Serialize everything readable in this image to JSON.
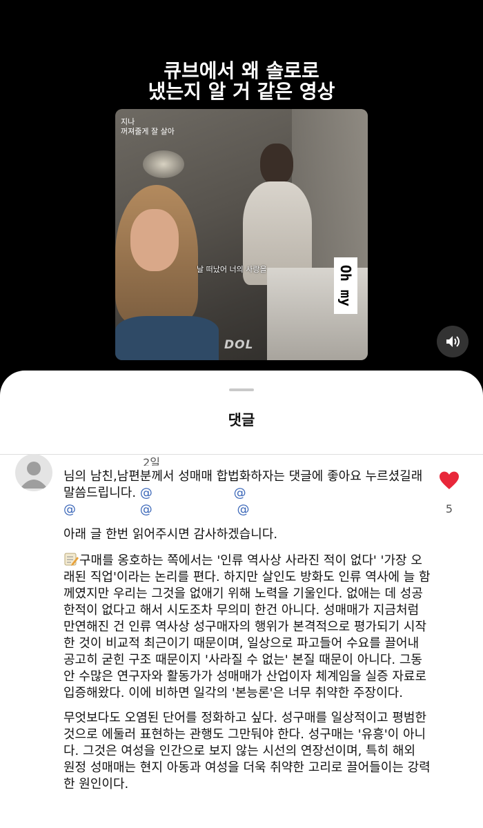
{
  "video": {
    "caption_line1": "큐브에서 왜 솔로로",
    "caption_line2": "냈는지 알 거 같은 영상",
    "overlay_top_line1": "지나",
    "overlay_top_line2": "꺼져줄게 잘 살아",
    "subtitle": "날 떠났어 너의 사랑을",
    "sticker_text": "Oh my",
    "watermark": "DOL"
  },
  "comments_sheet": {
    "title": "댓글"
  },
  "comment": {
    "time": "2일",
    "mentions_row1": [
      "@",
      "@"
    ],
    "mentions_row2": [
      "@",
      "@",
      "@"
    ],
    "intro": "님의 남친,남편분께서 성매매 합법화하자는 댓글에 좋아요 누르셨길래 말씀드립니다.",
    "request": "아래 글 한번 읽어주시면 감사하겠습니다.",
    "paragraph1": "구매를 옹호하는 쪽에서는 '인류 역사상 사라진 적이 없다' '가장 오래된 직업'이라는 논리를 편다. 하지만 살인도 방화도 인류 역사에 늘 함께였지만 우리는 그것을 없애기 위해 노력을 기울인다. 없애는 데 성공한적이 없다고 해서 시도조차 무의미 한건 아니다. 성매매가 지금처럼 만연해진 건 인류 역사상 성구매자의 행위가 본격적으로 평가되기 시작한 것이 비교적 최근이기 때문이며, 일상으로 파고들어 수요를 끌어내 공고히 굳힌 구조 때문이지 '사라질 수 없는' 본질 때문이 아니다. 그동안 수많은 연구자와 활동가가 성매매가 산업이자 체계임을 실증 자료로 입증해왔다. 이에 비하면 일각의 '본능론'은 너무 취약한 주장이다.",
    "paragraph2": "무엇보다도 오염된 단어를 정화하고 싶다. 성구매를 일상적이고 평범한것으로 에둘러 표현하는 관행도 그만둬야 한다. 성구매는 '유흥'이 아니다. 그것은 여성을 인간으로 보지 않는 시선의 연장선이며, 특히 해외 원정 성매매는 현지 아동과 여성을 더욱 취약한 고리로 끌어들이는 강력한 원인이다.",
    "like_count": "5",
    "like_color": "#e8273a"
  },
  "icons": [
    "volume-icon",
    "heart-icon",
    "memo-icon",
    "avatar-icon"
  ]
}
